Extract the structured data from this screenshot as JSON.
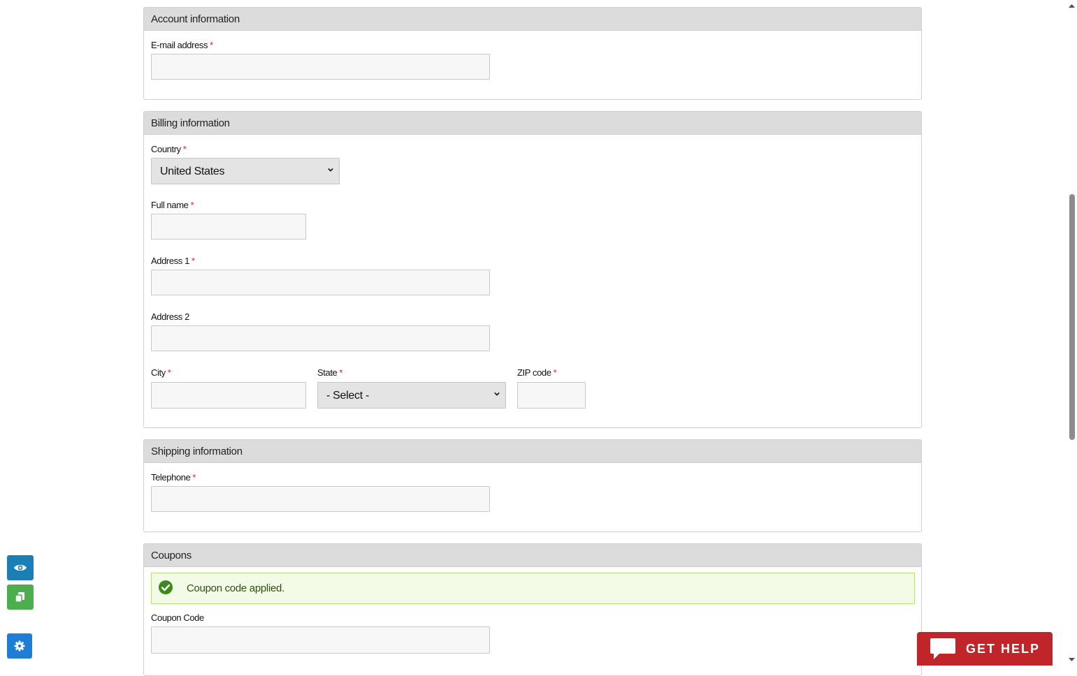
{
  "account": {
    "title": "Account information",
    "email_label": "E-mail address",
    "required_mark": "*"
  },
  "billing": {
    "title": "Billing information",
    "country_label": "Country",
    "country_value": "United States",
    "fullname_label": "Full name",
    "address1_label": "Address 1",
    "address2_label": "Address 2",
    "city_label": "City",
    "state_label": "State",
    "state_value": "- Select -",
    "zip_label": "ZIP code",
    "required_mark": "*"
  },
  "shipping": {
    "title": "Shipping information",
    "telephone_label": "Telephone",
    "required_mark": "*"
  },
  "coupons": {
    "title": "Coupons",
    "alert_text": "Coupon code applied.",
    "coupon_label": "Coupon Code"
  },
  "help_button": {
    "label": "GET HELP"
  },
  "side_buttons": [
    {
      "icon": "eye-icon",
      "color": "#1a7fb5"
    },
    {
      "icon": "copy-icon",
      "color": "#4cae4c"
    },
    {
      "icon": "gear-icon",
      "color": "#1e7ed6"
    }
  ],
  "colors": {
    "required": "#dd2222",
    "panel_header": "#dcdcdc",
    "alert_bg": "#f3fbe6",
    "alert_text": "#2f4e12",
    "help_bg": "#c0252a"
  }
}
